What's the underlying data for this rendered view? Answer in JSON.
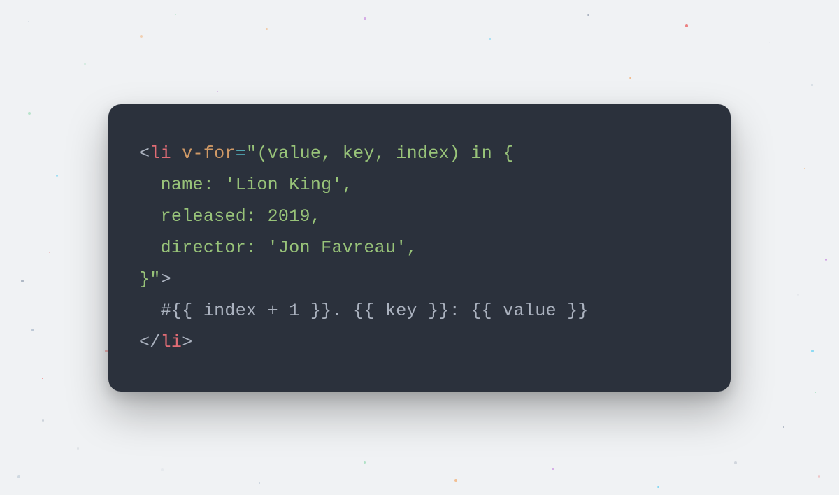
{
  "code": {
    "line1": {
      "open_bracket": "<",
      "tag": "li",
      "space": " ",
      "attr": "v-for",
      "eq": "=",
      "string_content": "\"(value, key, index) in {"
    },
    "line2": "  name: 'Lion King',",
    "line3": "  released: 2019,",
    "line4": "  director: 'Jon Favreau',",
    "line5": {
      "string_close": "}\"",
      "bracket": ">"
    },
    "line6": "  #{{ index + 1 }}. {{ key }}: {{ value }}",
    "line7": {
      "open_bracket": "</",
      "tag": "li",
      "close_bracket": ">"
    }
  },
  "colors": {
    "card_bg": "#2b313c",
    "page_bg": "#f0f2f4",
    "tag": "#e06c75",
    "attr": "#d19a66",
    "string": "#98c379",
    "default": "#abb2bf",
    "operator": "#56b6c2"
  }
}
